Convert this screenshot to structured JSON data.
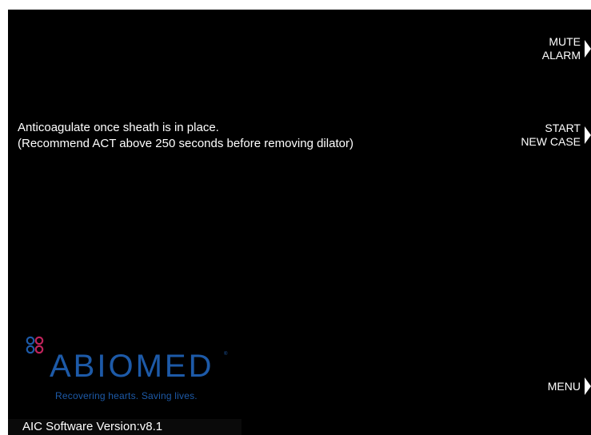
{
  "message": {
    "line1": "Anticoagulate once sheath is in place.",
    "line2": "(Recommend ACT above 250 seconds before removing dilator)"
  },
  "softkeys": {
    "mute_alarm": {
      "line1": "MUTE",
      "line2": "ALARM"
    },
    "start_new_case": {
      "line1": "START",
      "line2": "NEW CASE"
    },
    "menu": {
      "label": "MENU"
    }
  },
  "logo": {
    "wordmark": "ABIOMED",
    "registered": "®",
    "tagline": "Recovering hearts. Saving lives."
  },
  "footer": {
    "version": "AIC Software Version:v8.1"
  },
  "colors": {
    "screen_background": "#000000",
    "text": "#ffffff",
    "brand_blue": "#1d5aa8",
    "logo_pink": "#c0245c"
  }
}
